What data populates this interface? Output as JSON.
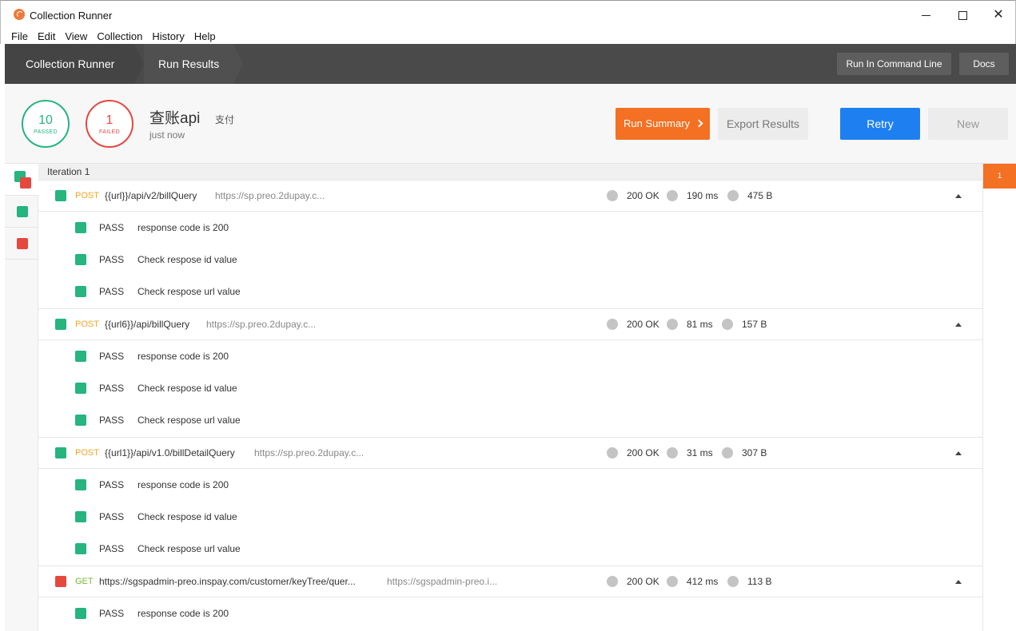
{
  "window": {
    "title": "Collection Runner",
    "controls": {
      "minimize": "minimize",
      "maximize": "maximize",
      "close": "✕"
    }
  },
  "menu": [
    "File",
    "Edit",
    "View",
    "Collection",
    "History",
    "Help"
  ],
  "header": {
    "crumbs": [
      "Collection Runner",
      "Run Results"
    ],
    "run_cmd_label": "Run In Command Line",
    "docs_label": "Docs"
  },
  "summary": {
    "passed_count": "10",
    "passed_label": "PASSED",
    "failed_count": "1",
    "failed_label": "FAILED",
    "collection_name": "查账api",
    "environment": "支付",
    "time": "just now",
    "run_summary_label": "Run Summary",
    "export_label": "Export Results",
    "retry_label": "Retry",
    "new_label": "New"
  },
  "iteration_tab": "1",
  "iteration": {
    "label": "Iteration 1",
    "requests": [
      {
        "status_color": "#26b47f",
        "method": "POST",
        "name": "{{url}}/api/v2/billQuery",
        "url": "https://sp.preo.2dupay.c...",
        "status": "200 OK",
        "time": "190 ms",
        "size": "475 B",
        "tests": [
          {
            "result": "PASS",
            "name": "response code is 200"
          },
          {
            "result": "PASS",
            "name": "Check respose id value"
          },
          {
            "result": "PASS",
            "name": "Check respose url value"
          }
        ]
      },
      {
        "status_color": "#26b47f",
        "method": "POST",
        "name": "{{url6}}/api/billQuery",
        "url": "https://sp.preo.2dupay.c...",
        "status": "200 OK",
        "time": "81 ms",
        "size": "157 B",
        "tests": [
          {
            "result": "PASS",
            "name": "response code is 200"
          },
          {
            "result": "PASS",
            "name": "Check respose id value"
          },
          {
            "result": "PASS",
            "name": "Check respose url value"
          }
        ]
      },
      {
        "status_color": "#26b47f",
        "method": "POST",
        "name": "{{url1}}/api/v1.0/billDetailQuery",
        "url": "https://sp.preo.2dupay.c...",
        "status": "200 OK",
        "time": "31 ms",
        "size": "307 B",
        "tests": [
          {
            "result": "PASS",
            "name": "response code is 200"
          },
          {
            "result": "PASS",
            "name": "Check respose id value"
          },
          {
            "result": "PASS",
            "name": "Check respose url value"
          }
        ]
      },
      {
        "status_color": "#e5483f",
        "method": "GET",
        "name": "https://sgspadmin-preo.inspay.com/customer/keyTree/quer...",
        "url": "https://sgspadmin-preo.i...",
        "status": "200 OK",
        "time": "412 ms",
        "size": "113 B",
        "tests": [
          {
            "result": "PASS",
            "name": "response code is 200"
          }
        ]
      }
    ]
  },
  "colors": {
    "pass": "#26b47f",
    "fail": "#e5483f",
    "accent_orange": "#f47023",
    "accent_blue": "#1e80f0",
    "post": "#f5a623",
    "get": "#7ab936"
  }
}
